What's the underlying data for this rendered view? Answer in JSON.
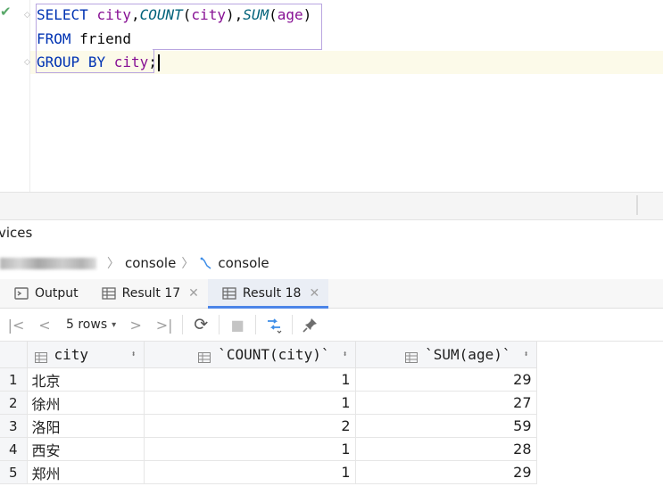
{
  "editor": {
    "lines": {
      "l1": {
        "kw": "SELECT",
        "col1": "city",
        "c1": ",",
        "fn1": "COUNT",
        "p1": "(",
        "arg1": "city",
        "p2": "),",
        "fn2": "SUM",
        "p3": "(",
        "arg2": "age",
        "p4": ")"
      },
      "l2": {
        "kw": "FROM",
        "table": "friend"
      },
      "l3": {
        "kw1": "GROUP",
        "kw2": "BY",
        "col": "city",
        "end": ";"
      }
    },
    "check_glyph": "✔",
    "check_color": "#59a869"
  },
  "services": {
    "title": "vices"
  },
  "breadcrumb": {
    "item1": "console",
    "item2": "console"
  },
  "tabs": [
    {
      "label": "Output"
    },
    {
      "label": "Result 17",
      "close": "✕"
    },
    {
      "label": "Result 18",
      "close": "✕"
    }
  ],
  "toolbar": {
    "first": "|<",
    "prev": "<",
    "rows_label": "5 rows",
    "next": ">",
    "last": ">|",
    "reload": "⟳",
    "stop": "■",
    "pin": "📌"
  },
  "grid": {
    "columns": [
      "city",
      "`COUNT(city)`",
      "`SUM(age)`"
    ],
    "sort_glyph": "⬍",
    "rows": [
      {
        "n": "1",
        "city": "北京",
        "count": "1",
        "sum": "29"
      },
      {
        "n": "2",
        "city": "徐州",
        "count": "1",
        "sum": "27"
      },
      {
        "n": "3",
        "city": "洛阳",
        "count": "2",
        "sum": "59"
      },
      {
        "n": "4",
        "city": "西安",
        "count": "1",
        "sum": "28"
      },
      {
        "n": "5",
        "city": "郑州",
        "count": "1",
        "sum": "29"
      }
    ]
  },
  "colors": {
    "accent": "#4a84e8",
    "keyword": "#0033b3",
    "identifier": "#871094",
    "function": "#00627a"
  }
}
